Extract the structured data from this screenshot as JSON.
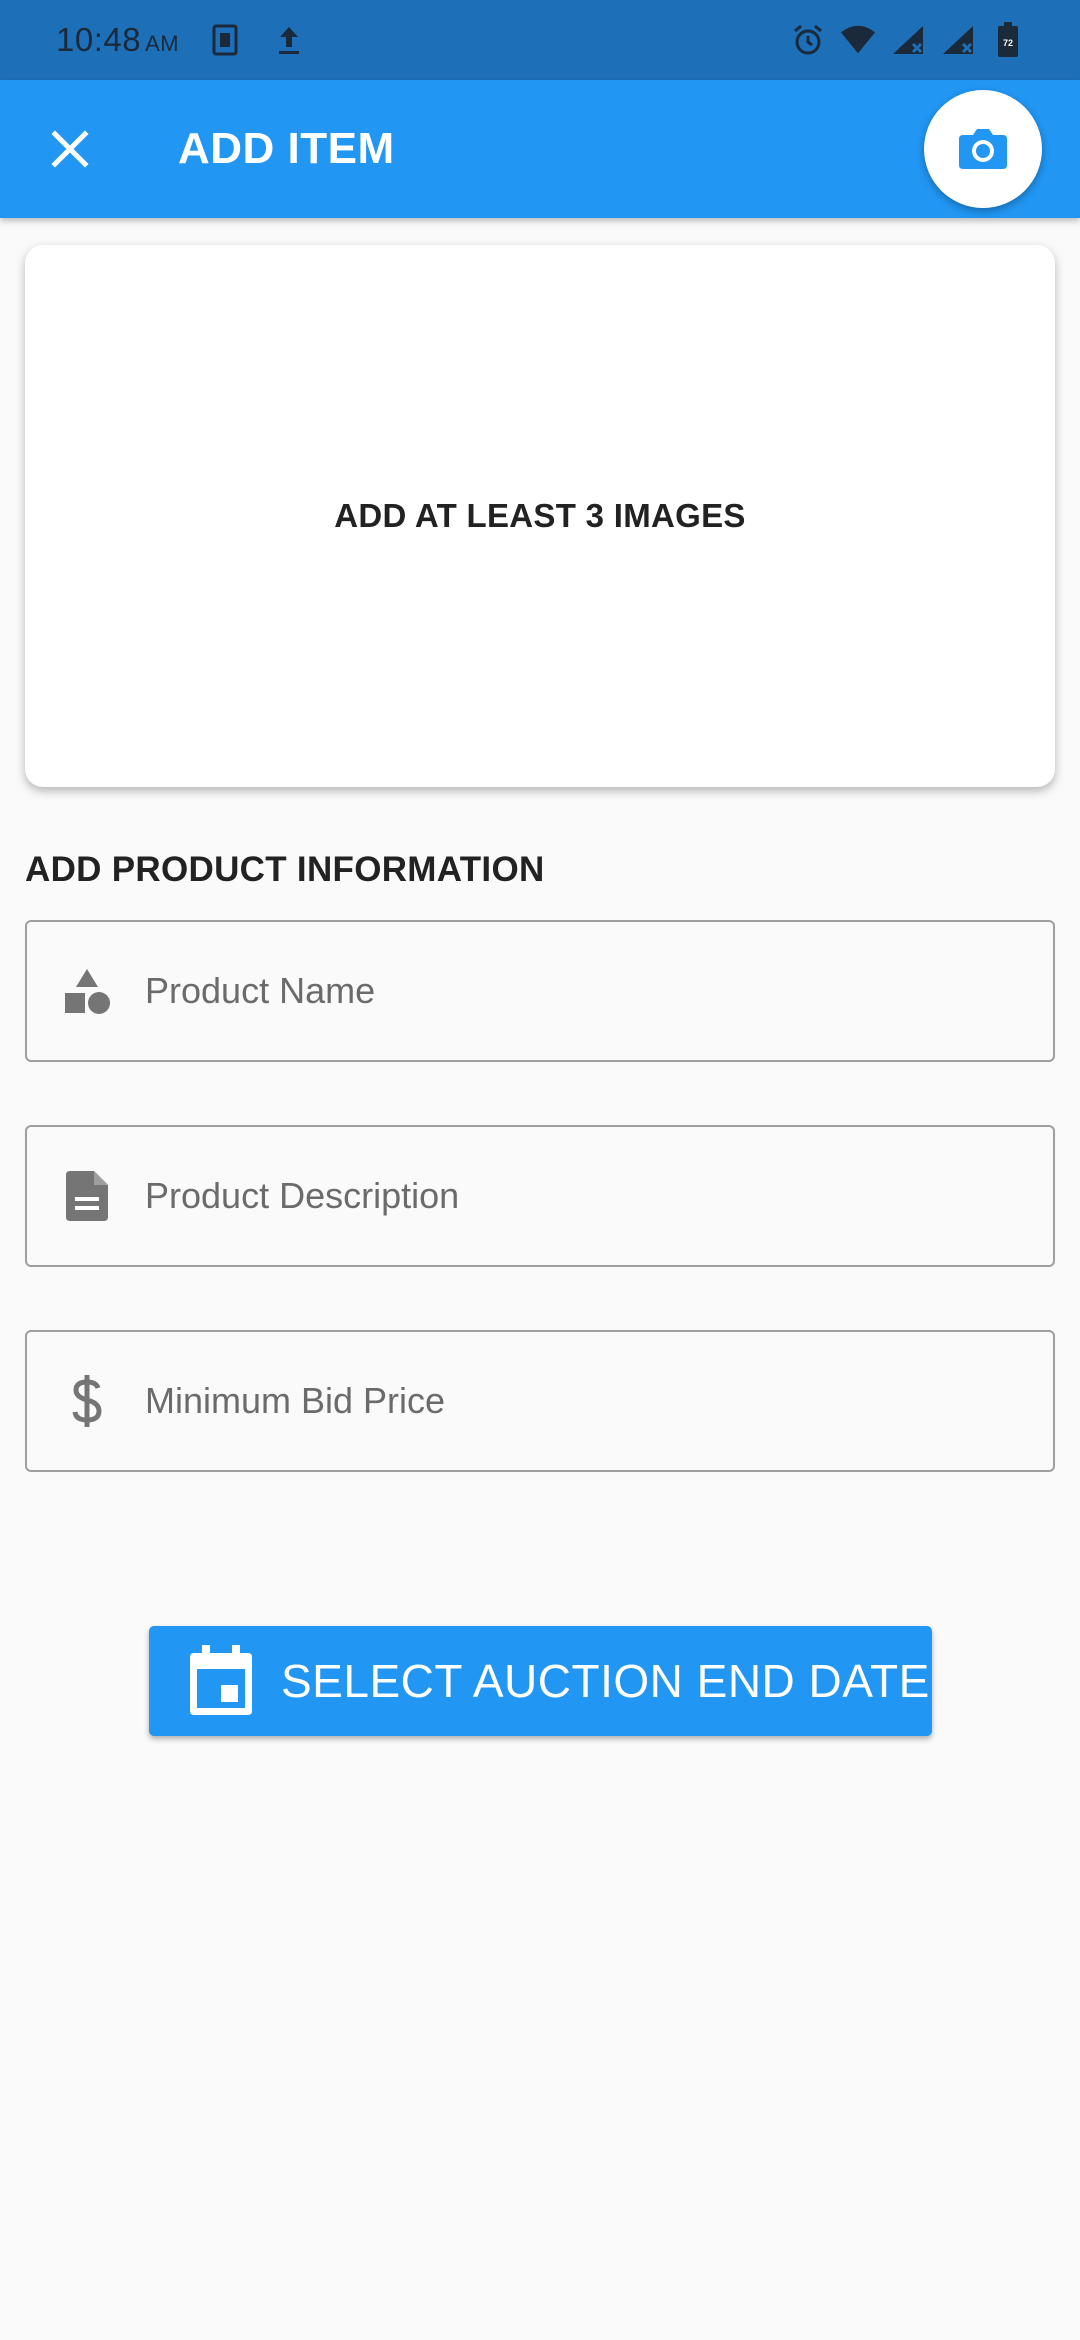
{
  "status_bar": {
    "time": "10:48",
    "ampm": "AM",
    "battery": "72"
  },
  "app_bar": {
    "title": "ADD ITEM"
  },
  "image_card": {
    "label": "ADD AT LEAST 3 IMAGES"
  },
  "form": {
    "section_title": "ADD PRODUCT INFORMATION",
    "fields": [
      {
        "icon": "category-shapes-icon",
        "placeholder": "Product Name"
      },
      {
        "icon": "document-icon",
        "placeholder": "Product Description"
      },
      {
        "icon": "dollar-icon",
        "placeholder": "Minimum Bid Price"
      }
    ]
  },
  "date_button": {
    "icon": "calendar-icon",
    "label": "SELECT AUCTION END DATE"
  },
  "colors": {
    "primary": "#2196f3",
    "status_bar": "#1d6fb8",
    "background": "#fafafa"
  }
}
